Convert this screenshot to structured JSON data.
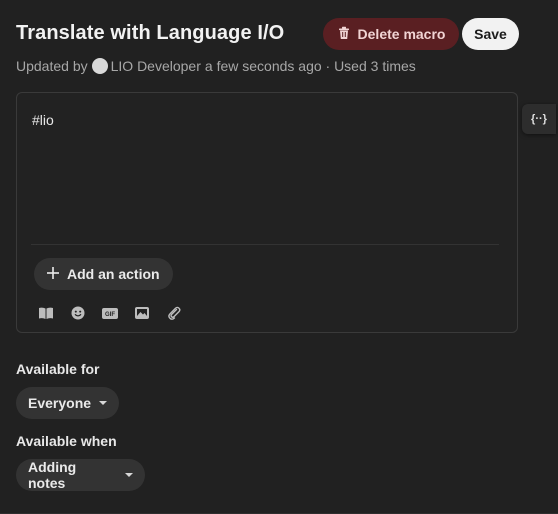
{
  "header": {
    "title": "Translate with Language I/O",
    "delete_label": "Delete macro",
    "save_label": "Save"
  },
  "meta": {
    "prefix": "Updated by",
    "author": "LIO Developer",
    "suffix": "a few seconds ago · Used 3 times"
  },
  "editor": {
    "content": "#lio",
    "add_action_label": "Add an action",
    "toolbar_icons": [
      "book-icon",
      "emoji-icon",
      "gif-icon",
      "image-icon",
      "attachment-icon"
    ]
  },
  "side_button": {
    "label": "{··}"
  },
  "available_for": {
    "label": "Available for",
    "value": "Everyone"
  },
  "available_when": {
    "label": "Available when",
    "value": "Adding notes"
  }
}
